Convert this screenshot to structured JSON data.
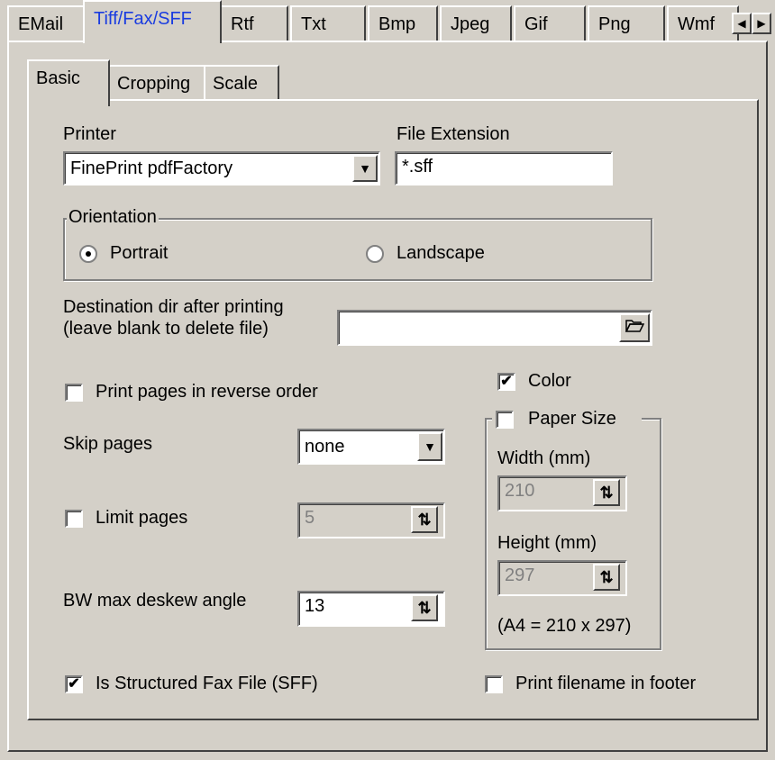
{
  "outer_tabs": [
    "EMail",
    "Tiff/Fax/SFF",
    "Rtf",
    "Txt",
    "Bmp",
    "Jpeg",
    "Gif",
    "Png",
    "Wmf"
  ],
  "inner_tabs": [
    "Basic",
    "Cropping",
    "Scale"
  ],
  "printer": {
    "label": "Printer",
    "value": "FinePrint pdfFactory"
  },
  "file_extension": {
    "label": "File Extension",
    "value": "*.sff"
  },
  "orientation": {
    "title": "Orientation",
    "portrait": "Portrait",
    "landscape": "Landscape",
    "selected": "Portrait"
  },
  "destination": {
    "line1": "Destination dir after printing",
    "line2": "(leave blank to delete file)",
    "value": ""
  },
  "reverse_order": {
    "label": "Print pages in reverse order",
    "checked": false
  },
  "skip_pages": {
    "label": "Skip pages",
    "value": "none"
  },
  "limit_pages": {
    "label": "Limit pages",
    "checked": false,
    "value": "5"
  },
  "deskew": {
    "label": "BW max deskew angle",
    "value": "13"
  },
  "color": {
    "label": "Color",
    "checked": true
  },
  "paper_size": {
    "label": "Paper Size",
    "checked": false,
    "width_label": "Width (mm)",
    "width": "210",
    "height_label": "Height (mm)",
    "height": "297",
    "note": "(A4 = 210 x 297)"
  },
  "sff": {
    "label": "Is Structured Fax File (SFF)",
    "checked": true
  },
  "print_filename": {
    "label": "Print filename in footer",
    "checked": false
  },
  "check_mark": "✔"
}
